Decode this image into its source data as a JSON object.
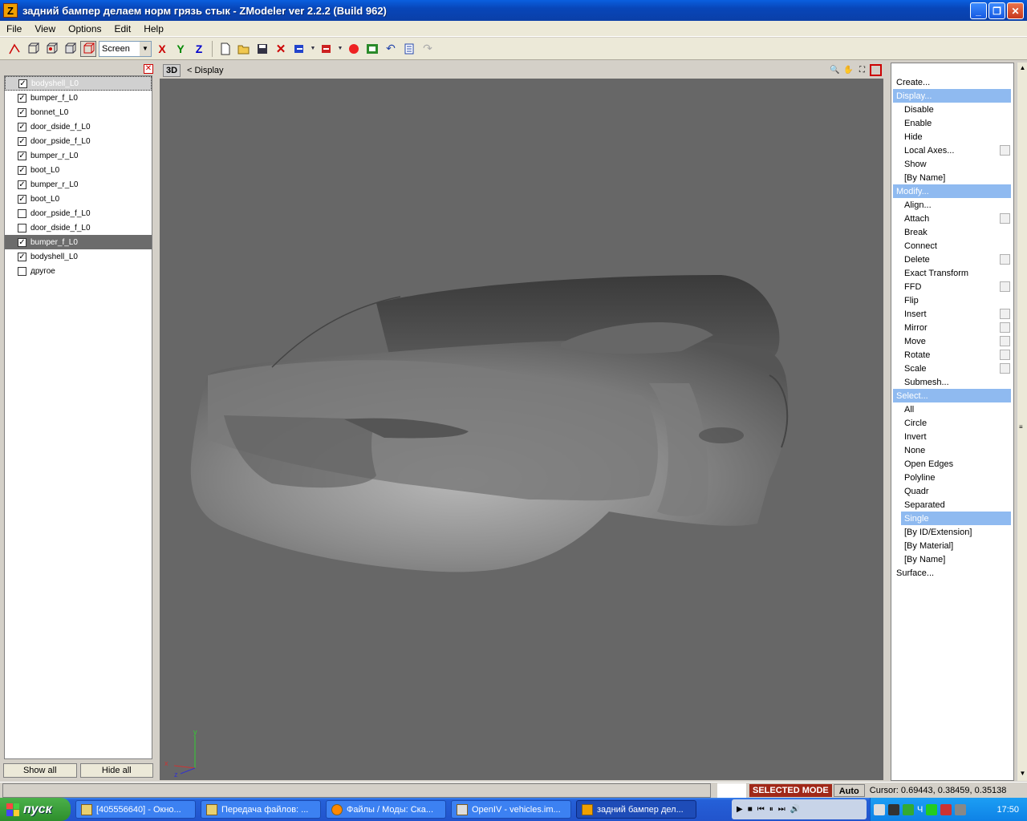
{
  "window": {
    "title": "задний бампер делаем норм грязь стык - ZModeler ver 2.2.2 (Build 962)",
    "icon_letter": "Z",
    "controls": [
      "_",
      "❐",
      "✕"
    ]
  },
  "menu": [
    "File",
    "View",
    "Options",
    "Edit",
    "Help"
  ],
  "toolbar": {
    "coord_system": "Screen",
    "axes": [
      "X",
      "Y",
      "Z"
    ]
  },
  "objects": [
    {
      "name": "bodyshell_L0",
      "checked": true
    },
    {
      "name": "bumper_f_L0",
      "checked": true
    },
    {
      "name": "bonnet_L0",
      "checked": true
    },
    {
      "name": "door_dside_f_L0",
      "checked": true
    },
    {
      "name": "door_pside_f_L0",
      "checked": true
    },
    {
      "name": "bumper_r_L0",
      "checked": true
    },
    {
      "name": "boot_L0",
      "checked": true
    },
    {
      "name": "bumper_r_L0",
      "checked": true
    },
    {
      "name": "boot_L0",
      "checked": true
    },
    {
      "name": "door_pside_f_L0",
      "checked": false
    },
    {
      "name": "door_dside_f_L0",
      "checked": false
    },
    {
      "name": "bumper_f_L0",
      "checked": true
    },
    {
      "name": "bodyshell_L0",
      "checked": true
    },
    {
      "name": "другое",
      "checked": false
    }
  ],
  "left_buttons": {
    "show_all": "Show all",
    "hide_all": "Hide all"
  },
  "viewport": {
    "mode": "3D",
    "breadcrumb": "< Display",
    "axis_labels": {
      "x": "x",
      "y": "y",
      "z": "z"
    }
  },
  "commands": [
    {
      "label": "Create...",
      "level": "head"
    },
    {
      "label": "Display...",
      "level": "head",
      "active": true
    },
    {
      "label": "Disable",
      "level": "sub"
    },
    {
      "label": "Enable",
      "level": "sub"
    },
    {
      "label": "Hide",
      "level": "sub"
    },
    {
      "label": "Local Axes...",
      "level": "sub",
      "box": true
    },
    {
      "label": "Show",
      "level": "sub"
    },
    {
      "label": "[By Name]",
      "level": "sub"
    },
    {
      "label": "Modify...",
      "level": "head",
      "active": true
    },
    {
      "label": "Align...",
      "level": "sub"
    },
    {
      "label": "Attach",
      "level": "sub",
      "box": true
    },
    {
      "label": "Break",
      "level": "sub"
    },
    {
      "label": "Connect",
      "level": "sub"
    },
    {
      "label": "Delete",
      "level": "sub",
      "box": true
    },
    {
      "label": "Exact Transform",
      "level": "sub"
    },
    {
      "label": "FFD",
      "level": "sub",
      "box": true
    },
    {
      "label": "Flip",
      "level": "sub"
    },
    {
      "label": "Insert",
      "level": "sub",
      "box": true
    },
    {
      "label": "Mirror",
      "level": "sub",
      "box": true
    },
    {
      "label": "Move",
      "level": "sub",
      "box": true
    },
    {
      "label": "Rotate",
      "level": "sub",
      "box": true
    },
    {
      "label": "Scale",
      "level": "sub",
      "box": true
    },
    {
      "label": "Submesh...",
      "level": "sub"
    },
    {
      "label": "Select...",
      "level": "head",
      "active": true
    },
    {
      "label": "All",
      "level": "sub"
    },
    {
      "label": "Circle",
      "level": "sub"
    },
    {
      "label": "Invert",
      "level": "sub"
    },
    {
      "label": "None",
      "level": "sub"
    },
    {
      "label": "Open Edges",
      "level": "sub"
    },
    {
      "label": "Polyline",
      "level": "sub"
    },
    {
      "label": "Quadr",
      "level": "sub"
    },
    {
      "label": "Separated",
      "level": "sub"
    },
    {
      "label": "Single",
      "level": "sub",
      "active": true
    },
    {
      "label": "[By ID/Extension]",
      "level": "sub"
    },
    {
      "label": "[By Material]",
      "level": "sub"
    },
    {
      "label": "[By Name]",
      "level": "sub"
    },
    {
      "label": "Surface...",
      "level": "head"
    }
  ],
  "status": {
    "mode": "SELECTED MODE",
    "auto": "Auto",
    "cursor": "Cursor: 0.69443, 0.38459, 0.35138"
  },
  "taskbar": {
    "start": "пуск",
    "tasks": [
      {
        "label": "[405556640] - Окно...",
        "active": false
      },
      {
        "label": "Передача файлов: ...",
        "active": false
      },
      {
        "label": "Файлы / Моды: Ска...",
        "active": false
      },
      {
        "label": "OpenIV - vehicles.im...",
        "active": false
      },
      {
        "label": "задний бампер дел...",
        "active": true
      }
    ],
    "lang": "Ч",
    "clock": "17:50"
  },
  "colors": {
    "viewport_bg": "#676767",
    "highlight": "#8fbaf0",
    "status_mode": "#a02818"
  }
}
